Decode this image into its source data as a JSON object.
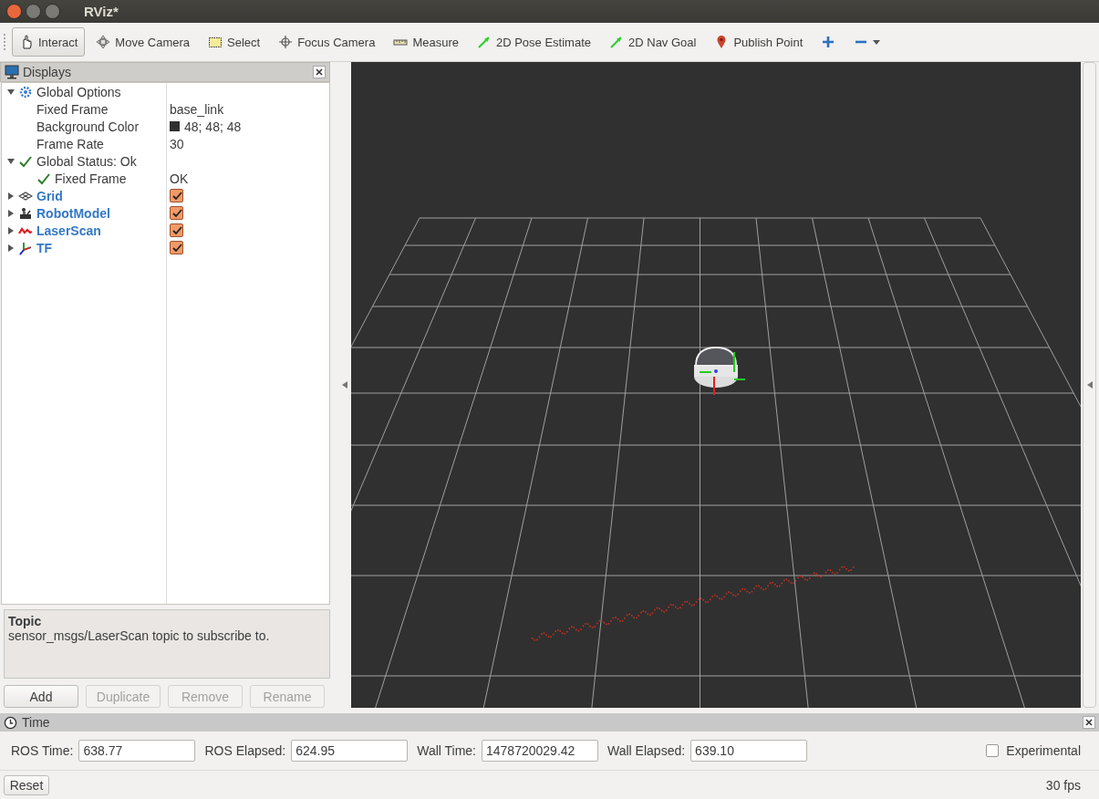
{
  "window": {
    "title": "RViz*"
  },
  "toolbar": [
    {
      "label": "Interact",
      "kind": "interact",
      "selected": true
    },
    {
      "label": "Move Camera",
      "kind": "move",
      "selected": false
    },
    {
      "label": "Select",
      "kind": "select",
      "selected": false
    },
    {
      "label": "Focus Camera",
      "kind": "focus",
      "selected": false
    },
    {
      "label": "Measure",
      "kind": "measure",
      "selected": false
    },
    {
      "label": "2D Pose Estimate",
      "kind": "pose",
      "selected": false
    },
    {
      "label": "2D Nav Goal",
      "kind": "goal",
      "selected": false
    },
    {
      "label": "Publish Point",
      "kind": "point",
      "selected": false
    },
    {
      "kind": "add",
      "selected": false
    },
    {
      "kind": "remove",
      "selected": false
    }
  ],
  "displays": {
    "title": "Displays",
    "items": [
      {
        "label": "Global Options",
        "kind": "options",
        "expanded": true,
        "children": [
          {
            "label": "Fixed Frame",
            "kind": "property",
            "value": "base_link"
          },
          {
            "label": "Background Color",
            "kind": "property",
            "value": "48; 48; 48",
            "color": "#303030"
          },
          {
            "label": "Frame Rate",
            "kind": "property",
            "value": "30"
          }
        ]
      },
      {
        "label": "Global Status: Ok",
        "kind": "status",
        "expanded": true,
        "children": [
          {
            "label": "Fixed Frame",
            "kind": "status",
            "value": "OK"
          }
        ]
      },
      {
        "label": "Grid",
        "kind": "grid",
        "expanded": false,
        "checked": true
      },
      {
        "label": "RobotModel",
        "kind": "robot",
        "expanded": false,
        "checked": true
      },
      {
        "label": "LaserScan",
        "kind": "laser",
        "expanded": false,
        "checked": true
      },
      {
        "label": "TF",
        "kind": "tf",
        "expanded": false,
        "checked": true
      }
    ],
    "description": {
      "title": "Topic",
      "text": "sensor_msgs/LaserScan topic to subscribe to."
    },
    "buttons": [
      {
        "label": "Add",
        "disabled": false
      },
      {
        "label": "Duplicate",
        "disabled": true
      },
      {
        "label": "Remove",
        "disabled": true
      },
      {
        "label": "Rename",
        "disabled": true
      }
    ]
  },
  "time": {
    "title": "Time",
    "fields": [
      {
        "label": "ROS Time:",
        "value": "638.77"
      },
      {
        "label": "ROS Elapsed:",
        "value": "624.95"
      },
      {
        "label": "Wall Time:",
        "value": "1478720029.42"
      },
      {
        "label": "Wall Elapsed:",
        "value": "639.10"
      }
    ],
    "experimental": {
      "label": "Experimental",
      "checked": false
    },
    "reset": "Reset",
    "fps": "30 fps"
  }
}
